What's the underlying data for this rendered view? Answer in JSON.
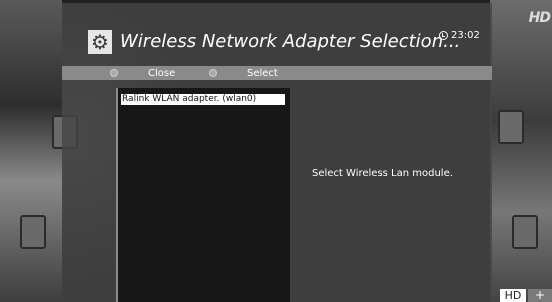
{
  "dialog": {
    "title": "Wireless Network Adapter Selection...",
    "clock": "23:02",
    "description": "Select Wireless Lan module."
  },
  "menubar": {
    "close_label": "Close",
    "select_label": "Select"
  },
  "adapters": [
    {
      "label": "Ralink WLAN adapter. (wlan0)",
      "selected": true
    }
  ],
  "channel": {
    "logo_text": "HD",
    "hd_badge": "HD",
    "plus_badge": "+"
  },
  "colors": {
    "panel": "#464646",
    "menubar": "#8a8a8a",
    "selection": "#ffffff"
  },
  "icons": {
    "settings": "gear-icon",
    "clock": "clock-icon"
  }
}
